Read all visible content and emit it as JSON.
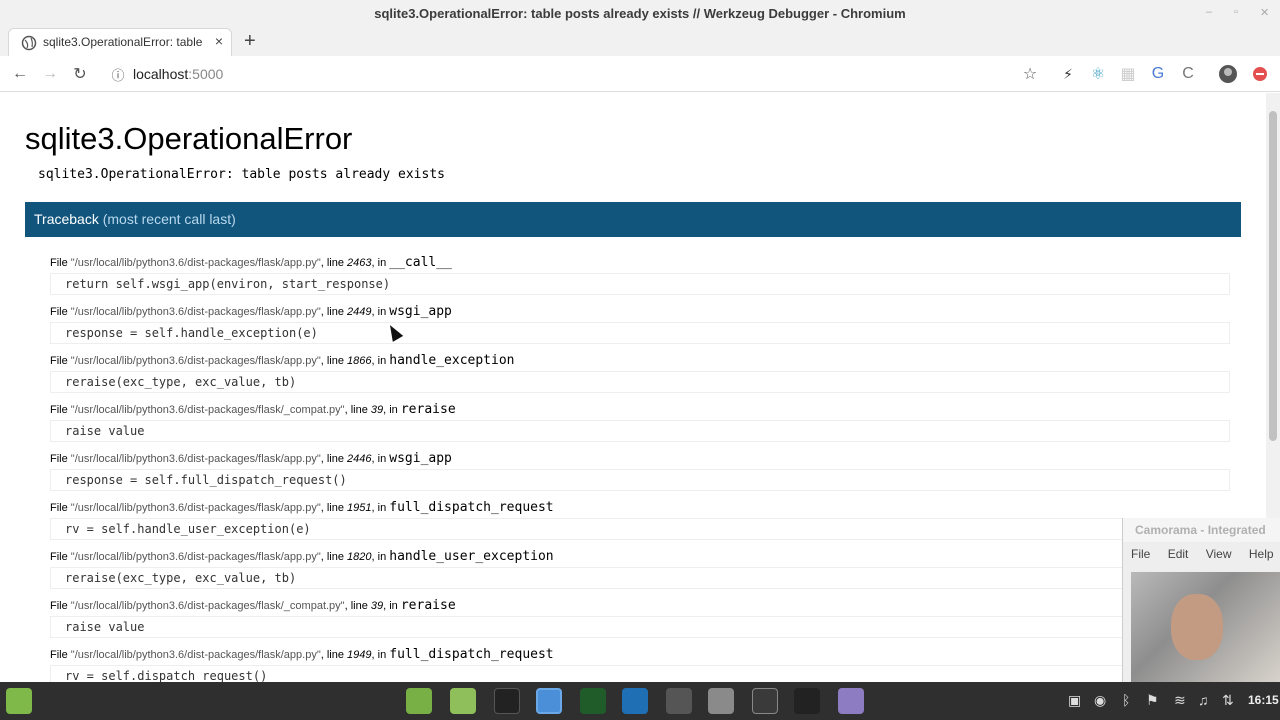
{
  "window": {
    "title": "sqlite3.OperationalError: table posts already exists // Werkzeug Debugger - Chromium"
  },
  "tab": {
    "title": "sqlite3.OperationalError: table",
    "close": "×",
    "new": "+"
  },
  "toolbar": {
    "url_host": "localhost",
    "url_port": ":5000"
  },
  "error": {
    "title": "sqlite3.OperationalError",
    "message": "sqlite3.OperationalError: table posts already exists"
  },
  "traceback": {
    "label": "Traceback",
    "sub": "(most recent call last)",
    "frames": [
      {
        "path": "\"/usr/local/lib/python3.6/dist-packages/flask/app.py\"",
        "line": "2463",
        "fn": "__call__",
        "code": "return self.wsgi_app(environ, start_response)"
      },
      {
        "path": "\"/usr/local/lib/python3.6/dist-packages/flask/app.py\"",
        "line": "2449",
        "fn": "wsgi_app",
        "code": "response = self.handle_exception(e)"
      },
      {
        "path": "\"/usr/local/lib/python3.6/dist-packages/flask/app.py\"",
        "line": "1866",
        "fn": "handle_exception",
        "code": "reraise(exc_type, exc_value, tb)"
      },
      {
        "path": "\"/usr/local/lib/python3.6/dist-packages/flask/_compat.py\"",
        "line": "39",
        "fn": "reraise",
        "code": "raise value"
      },
      {
        "path": "\"/usr/local/lib/python3.6/dist-packages/flask/app.py\"",
        "line": "2446",
        "fn": "wsgi_app",
        "code": "response = self.full_dispatch_request()"
      },
      {
        "path": "\"/usr/local/lib/python3.6/dist-packages/flask/app.py\"",
        "line": "1951",
        "fn": "full_dispatch_request",
        "code": "rv = self.handle_user_exception(e)"
      },
      {
        "path": "\"/usr/local/lib/python3.6/dist-packages/flask/app.py\"",
        "line": "1820",
        "fn": "handle_user_exception",
        "code": "reraise(exc_type, exc_value, tb)"
      },
      {
        "path": "\"/usr/local/lib/python3.6/dist-packages/flask/_compat.py\"",
        "line": "39",
        "fn": "reraise",
        "code": "raise value"
      },
      {
        "path": "\"/usr/local/lib/python3.6/dist-packages/flask/app.py\"",
        "line": "1949",
        "fn": "full_dispatch_request",
        "code": "rv = self.dispatch_request()"
      }
    ],
    "file_word": "File",
    "line_word": ", line ",
    "in_word": ", in "
  },
  "camorama": {
    "title": "Camorama - Integrated",
    "menu": [
      "File",
      "Edit",
      "View",
      "Help"
    ]
  },
  "taskbar": {
    "clock": "16:15"
  }
}
